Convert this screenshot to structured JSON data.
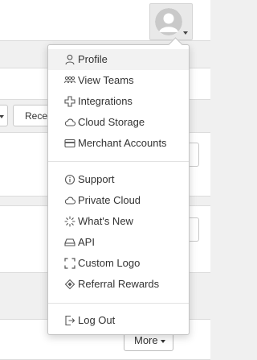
{
  "toolbar": {
    "recent_label": "Recen"
  },
  "more_button": {
    "label": "More"
  },
  "menu": {
    "groups": [
      [
        {
          "label": "Profile",
          "icon": "person-icon"
        },
        {
          "label": "View Teams",
          "icon": "team-icon"
        },
        {
          "label": "Integrations",
          "icon": "plus-square-icon"
        },
        {
          "label": "Cloud Storage",
          "icon": "cloud-icon"
        },
        {
          "label": "Merchant Accounts",
          "icon": "credit-card-icon"
        }
      ],
      [
        {
          "label": "Support",
          "icon": "info-icon"
        },
        {
          "label": "Private Cloud",
          "icon": "cloud-icon"
        },
        {
          "label": "What's New",
          "icon": "sparkle-icon"
        },
        {
          "label": "API",
          "icon": "drive-icon"
        },
        {
          "label": "Custom Logo",
          "icon": "frame-corners-icon"
        },
        {
          "label": "Referral Rewards",
          "icon": "ticket-icon"
        }
      ],
      [
        {
          "label": "Log Out",
          "icon": "logout-icon"
        }
      ]
    ]
  }
}
